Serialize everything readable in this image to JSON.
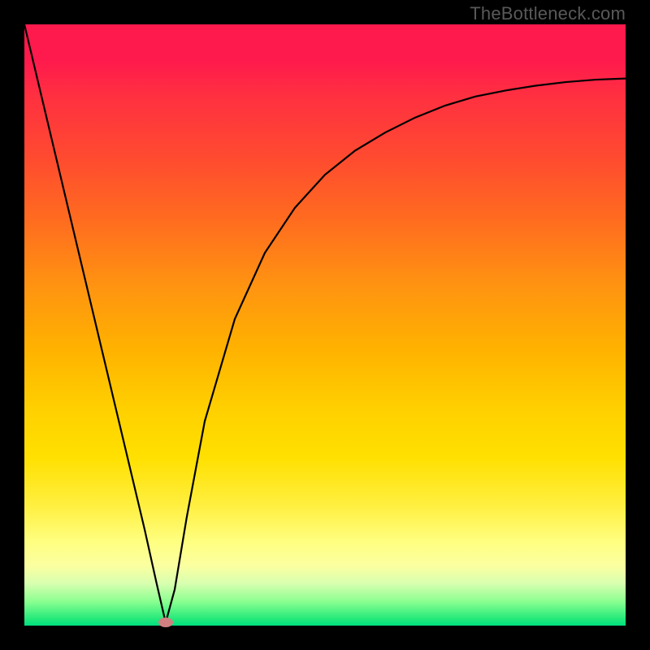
{
  "watermark": "TheBottleneck.com",
  "chart_data": {
    "type": "line",
    "title": "",
    "xlabel": "",
    "ylabel": "",
    "xlim": [
      0,
      100
    ],
    "ylim": [
      0,
      100
    ],
    "grid": false,
    "legend": false,
    "series": [
      {
        "name": "curve",
        "x": [
          0,
          5,
          10,
          15,
          20,
          22,
          23.5,
          25,
          27,
          30,
          35,
          40,
          45,
          50,
          55,
          60,
          65,
          70,
          75,
          80,
          85,
          90,
          95,
          100
        ],
        "y": [
          100,
          79,
          58,
          37,
          16,
          7,
          0.5,
          6,
          18,
          34,
          51,
          62,
          69.5,
          75,
          79,
          82,
          84.5,
          86.5,
          88,
          89,
          89.8,
          90.4,
          90.8,
          91
        ]
      }
    ],
    "marker": {
      "x": 23.5,
      "y": 0.5
    },
    "background_gradient": {
      "top_color": "#ff1a4d",
      "bottom_color": "#00e080",
      "description": "vertical red-orange-yellow-green gradient"
    },
    "curve_color": "#000000",
    "marker_color": "#d08080"
  }
}
